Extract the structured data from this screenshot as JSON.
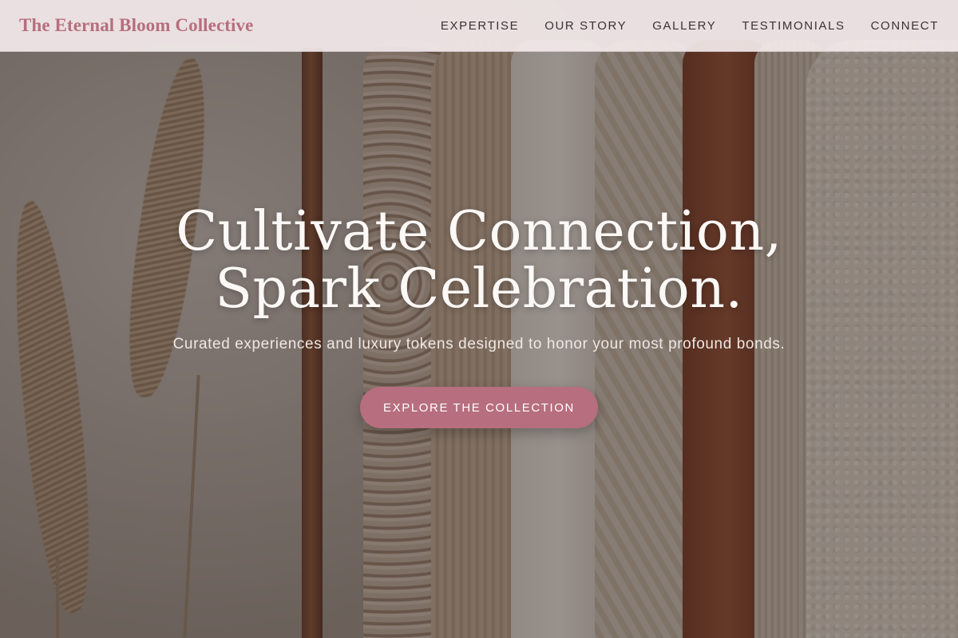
{
  "colors": {
    "accent": "#b76e7e",
    "nav_background": "#f4eaec",
    "headline_text": "#fbf8f6"
  },
  "navbar": {
    "brand": "The Eternal Bloom Collective",
    "links": [
      {
        "label": "EXPERTISE"
      },
      {
        "label": "OUR STORY"
      },
      {
        "label": "GALLERY"
      },
      {
        "label": "TESTIMONIALS"
      },
      {
        "label": "CONNECT"
      }
    ]
  },
  "hero": {
    "headline_line1": "Cultivate Connection,",
    "headline_line2": "Spark Celebration.",
    "subheadline": "Curated experiences and luxury tokens designed to honor your most profound bonds.",
    "cta_label": "EXPLORE THE COLLECTION"
  }
}
